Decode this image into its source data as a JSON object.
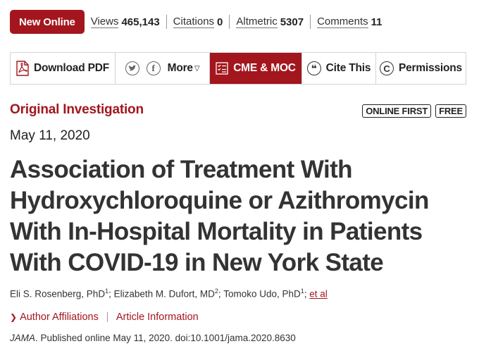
{
  "metrics_bar": {
    "badge": "New Online",
    "items": [
      {
        "label": "Views",
        "value": "465,143"
      },
      {
        "label": "Citations",
        "value": "0"
      },
      {
        "label": "Altmetric",
        "value": "5307"
      },
      {
        "label": "Comments",
        "value": "11"
      }
    ]
  },
  "toolbar": {
    "download_pdf": "Download PDF",
    "more": "More",
    "cme": "CME & MOC",
    "cite": "Cite This",
    "permissions": "Permissions"
  },
  "colors": {
    "brand_red": "#a3161d"
  },
  "article": {
    "type": "Original Investigation",
    "tags": [
      "ONLINE FIRST",
      "FREE"
    ],
    "date": "May 11, 2020",
    "title": "Association of Treatment With Hydroxychloroquine or Azithromycin With In-Hospital Mortality in Patients With COVID-19 in New York State",
    "authors": [
      {
        "name": "Eli S. Rosenberg, PhD",
        "aff": "1"
      },
      {
        "name": "Elizabeth M. Dufort, MD",
        "aff": "2"
      },
      {
        "name": "Tomoko Udo, PhD",
        "aff": "1"
      }
    ],
    "et_al": "et al",
    "links": {
      "affiliations": "Author Affiliations",
      "info": "Article Information"
    },
    "citation": {
      "journal": "JAMA",
      "text": ". Published online May 11, 2020. doi:10.1001/jama.2020.8630"
    }
  }
}
